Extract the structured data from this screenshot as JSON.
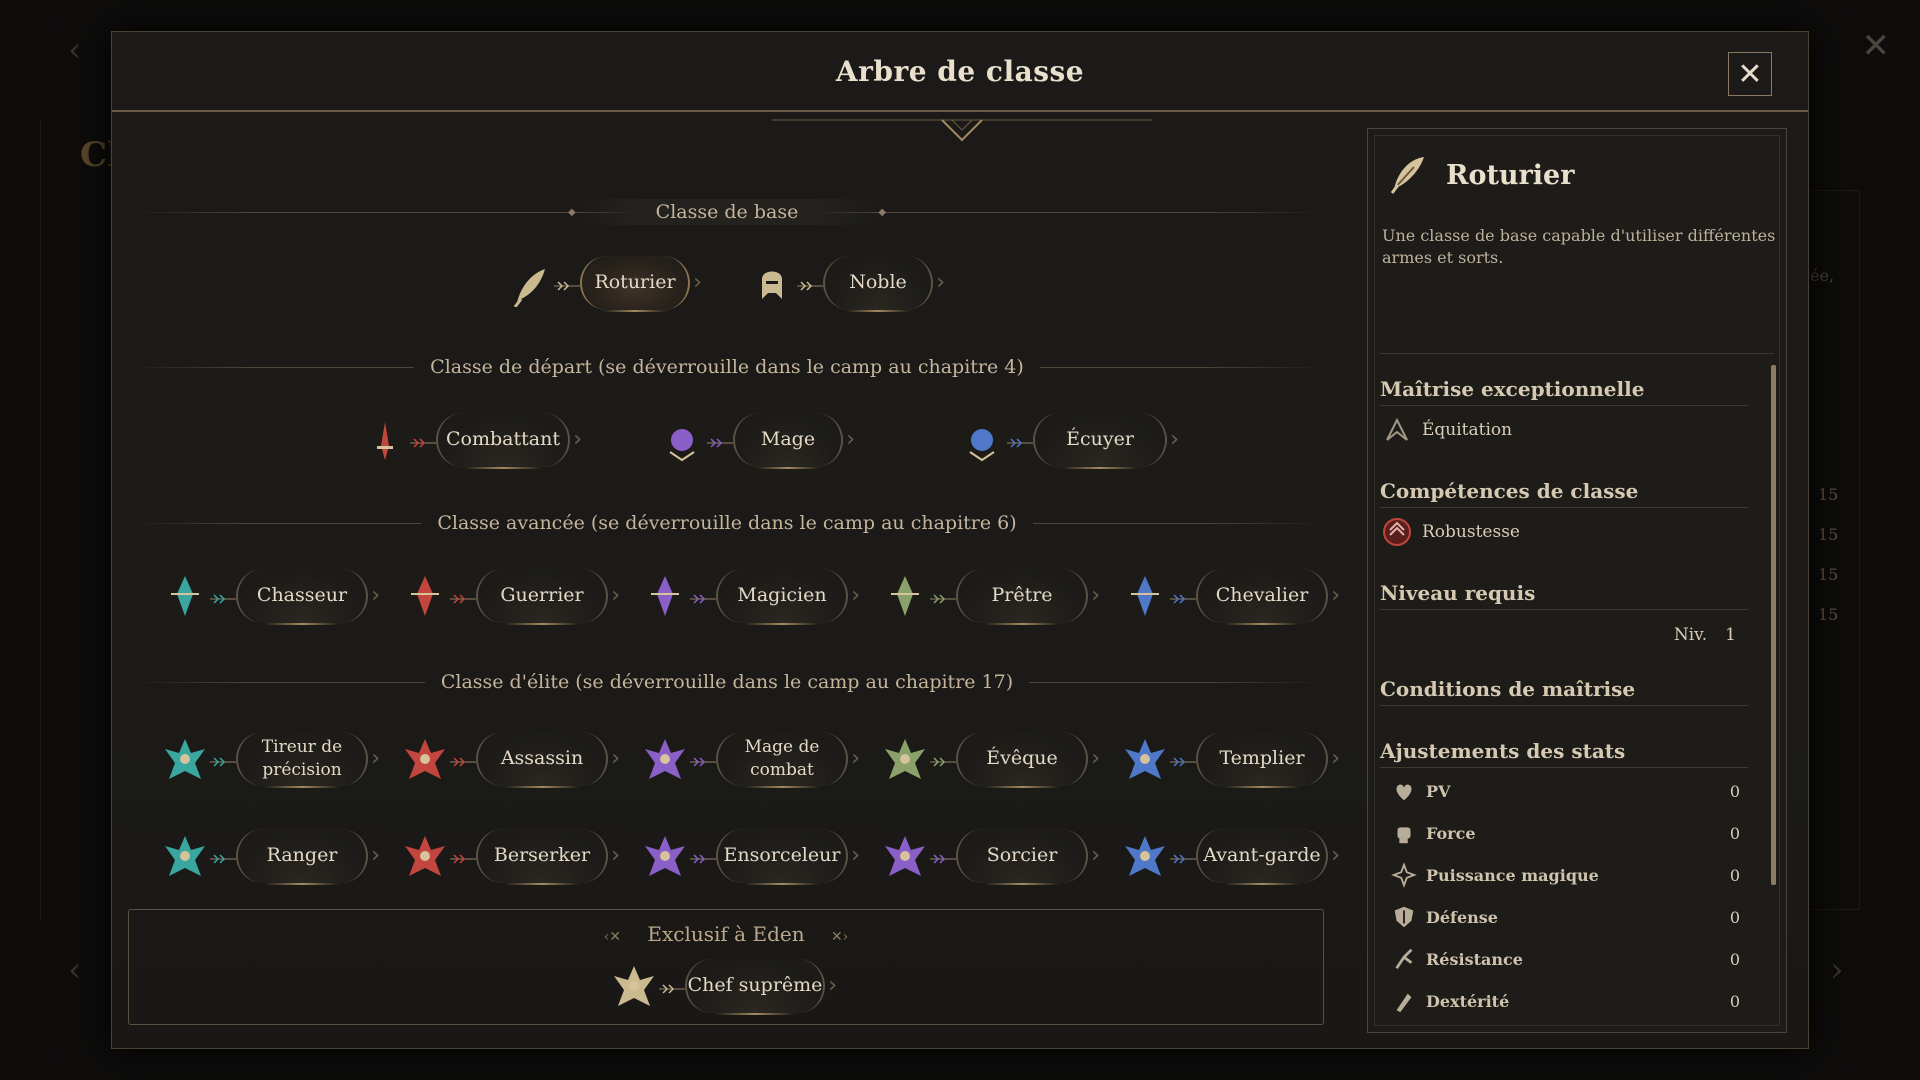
{
  "modal": {
    "title": "Arbre de classe",
    "close_label": "✕"
  },
  "background": {
    "side_numbers": [
      "15",
      "15",
      "15",
      "15"
    ],
    "left_text": "Cl",
    "right_text": "ée,"
  },
  "sections": {
    "base": "Classe de base",
    "start": "Classe de départ (se déverrouille dans le camp au chapitre 4)",
    "advanced": "Classe avancée (se déverrouille dans le camp au chapitre 6)",
    "elite": "Classe d'élite (se déverrouille dans le camp au chapitre 17)",
    "eden": "Exclusif à Eden"
  },
  "classes": {
    "base": [
      {
        "label": "Roturier",
        "icon": "feather-icon",
        "color": "#cbb98f",
        "selected": true
      },
      {
        "label": "Noble",
        "icon": "knight-helmet-icon",
        "color": "#cbb98f",
        "selected": false
      }
    ],
    "start": [
      {
        "label": "Combattant",
        "icon": "sword-icon",
        "color": "#c2463d"
      },
      {
        "label": "Mage",
        "icon": "moon-orb-icon",
        "color": "#8a5fc8"
      },
      {
        "label": "Écuyer",
        "icon": "shield-orb-icon",
        "color": "#4f78c9"
      }
    ],
    "advanced": [
      {
        "label": "Chasseur",
        "icon": "bow-icon",
        "color": "#3aa6a0"
      },
      {
        "label": "Guerrier",
        "icon": "axe-icon",
        "color": "#c2463d"
      },
      {
        "label": "Magicien",
        "icon": "arcane-icon",
        "color": "#8a5fc8"
      },
      {
        "label": "Prêtre",
        "icon": "cross-staff-icon",
        "color": "#8aa26a"
      },
      {
        "label": "Chevalier",
        "icon": "helm-icon",
        "color": "#4f78c9"
      }
    ],
    "elite1": [
      {
        "label": "Tireur de précision",
        "icon": "crossbow-icon",
        "color": "#3aa6a0"
      },
      {
        "label": "Assassin",
        "icon": "winged-blade-icon",
        "color": "#c2463d"
      },
      {
        "label": "Mage de combat",
        "icon": "battlemage-icon",
        "color": "#8a5fc8"
      },
      {
        "label": "Évêque",
        "icon": "bishop-icon",
        "color": "#8aa26a"
      },
      {
        "label": "Templier",
        "icon": "templar-icon",
        "color": "#4f78c9"
      }
    ],
    "elite2": [
      {
        "label": "Ranger",
        "icon": "ranger-icon",
        "color": "#3aa6a0"
      },
      {
        "label": "Berserker",
        "icon": "berserker-icon",
        "color": "#c2463d"
      },
      {
        "label": "Ensorceleur",
        "icon": "sorcery-icon",
        "color": "#8a5fc8"
      },
      {
        "label": "Sorcier",
        "icon": "warlock-icon",
        "color": "#8a5fc8"
      },
      {
        "label": "Avant-garde",
        "icon": "vanguard-icon",
        "color": "#4f78c9"
      }
    ],
    "eden": [
      {
        "label": "Chef suprême",
        "icon": "crown-icon",
        "color": "#cbb98f"
      }
    ]
  },
  "detail": {
    "name": "Roturier",
    "icon": "feather-icon",
    "description": "Une classe de base capable d'utiliser différentes armes et sorts.",
    "mastery_heading": "Maîtrise exceptionnelle",
    "mastery_item": "Équitation",
    "skills_heading": "Compétences de classe",
    "skills_item": "Robustesse",
    "level_heading": "Niveau requis",
    "level_label": "Niv.",
    "level_value": "1",
    "conditions_heading": "Conditions de maîtrise",
    "stats_heading": "Ajustements des stats",
    "stats": [
      {
        "label": "PV",
        "value": "0",
        "icon": "heart-icon"
      },
      {
        "label": "Force",
        "value": "0",
        "icon": "fist-icon"
      },
      {
        "label": "Puissance magique",
        "value": "0",
        "icon": "magic-spark-icon"
      },
      {
        "label": "Défense",
        "value": "0",
        "icon": "shield-icon"
      },
      {
        "label": "Résistance",
        "value": "0",
        "icon": "resistance-icon"
      },
      {
        "label": "Dextérité",
        "value": "0",
        "icon": "dexterity-icon"
      }
    ]
  }
}
